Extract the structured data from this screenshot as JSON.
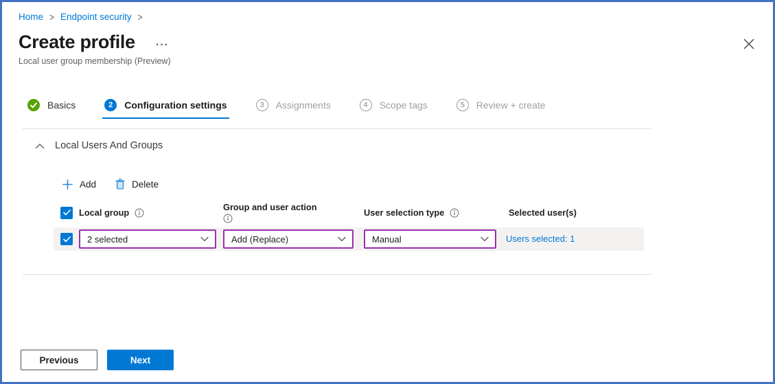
{
  "colors": {
    "accent": "#0078d4",
    "success_green": "#57a300",
    "changed_setting_purple": "#9730ad",
    "frame_border": "#4472c4",
    "row_background": "#f3f2f1"
  },
  "breadcrumb": {
    "items": [
      {
        "label": "Home"
      },
      {
        "label": "Endpoint security"
      }
    ],
    "separator": ">"
  },
  "header": {
    "title": "Create profile",
    "more": "···",
    "subtitle": "Local user group membership (Preview)"
  },
  "steps": [
    {
      "label": "Basics",
      "state": "complete"
    },
    {
      "number": "2",
      "label": "Configuration settings",
      "state": "active"
    },
    {
      "number": "3",
      "label": "Assignments",
      "state": "upcoming"
    },
    {
      "number": "4",
      "label": "Scope tags",
      "state": "upcoming"
    },
    {
      "number": "5",
      "label": "Review + create",
      "state": "upcoming"
    }
  ],
  "section": {
    "title": "Local Users And Groups"
  },
  "toolbar": {
    "add": "Add",
    "delete": "Delete"
  },
  "table": {
    "headers": {
      "local_group": "Local group",
      "group_action": "Group and user action",
      "selection_type": "User selection type",
      "selected_users": "Selected user(s)"
    },
    "row": {
      "local_group": "2 selected",
      "group_action": "Add (Replace)",
      "selection_type": "Manual",
      "selected_users_link": "Users selected: 1"
    }
  },
  "footer": {
    "previous": "Previous",
    "next": "Next"
  }
}
